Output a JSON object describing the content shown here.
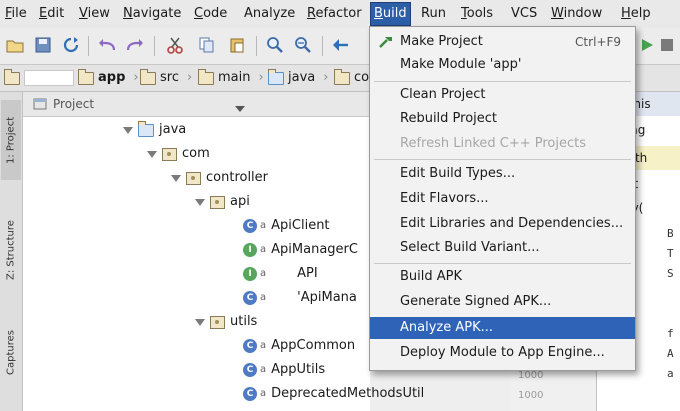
{
  "menubar": {
    "items": [
      {
        "label": "File",
        "mnemonic": "F",
        "rest": "ile"
      },
      {
        "label": "Edit",
        "mnemonic": "E",
        "rest": "dit"
      },
      {
        "label": "View",
        "mnemonic": "V",
        "rest": "iew"
      },
      {
        "label": "Navigate",
        "mnemonic": "N",
        "rest": "avigate"
      },
      {
        "label": "Code",
        "mnemonic": "C",
        "rest": "ode"
      },
      {
        "label": "Analyze",
        "mnemonic": "",
        "rest": "Analyze"
      },
      {
        "label": "Refactor",
        "mnemonic": "R",
        "rest": "efactor"
      },
      {
        "label": "Build",
        "mnemonic": "B",
        "rest": "uild"
      },
      {
        "label": "Run",
        "mnemonic": "",
        "rest": "Run"
      },
      {
        "label": "Tools",
        "mnemonic": "T",
        "rest": "ools"
      },
      {
        "label": "VCS",
        "mnemonic": "",
        "rest": "VCS"
      },
      {
        "label": "Window",
        "mnemonic": "W",
        "rest": "indow"
      },
      {
        "label": "Help",
        "mnemonic": "H",
        "rest": "elp"
      }
    ]
  },
  "breadcrumb": {
    "items": [
      "app",
      "src",
      "main",
      "java",
      "co"
    ]
  },
  "project_panel": {
    "title": "Project"
  },
  "left_strip": {
    "tabs": [
      "1: Project",
      "Z: Structure",
      "Captures"
    ]
  },
  "tree": {
    "rows": [
      {
        "label": "java",
        "kind": "folder"
      },
      {
        "label": "com",
        "kind": "package"
      },
      {
        "label": "controller",
        "kind": "package"
      },
      {
        "label": "api",
        "kind": "package"
      },
      {
        "label": "ApiClient",
        "kind": "class",
        "badge": "c"
      },
      {
        "label": "ApiManagerC",
        "kind": "interface",
        "badge": "i"
      },
      {
        "label": "API",
        "kind": "interface",
        "badge": "i"
      },
      {
        "label": "'ApiMana",
        "kind": "class",
        "badge": "c"
      },
      {
        "label": "utils",
        "kind": "package"
      },
      {
        "label": "AppCommon",
        "kind": "class",
        "badge": "c"
      },
      {
        "label": "AppUtils",
        "kind": "class",
        "badge": "c"
      },
      {
        "label": "DeprecatedMethodsUtil",
        "kind": "class",
        "badge": "c"
      }
    ]
  },
  "editor": {
    "tabs": [
      "eptionis",
      "rmFrag",
      "ed with",
      "strat",
      "sibilty("
    ],
    "code_chars": [
      "B",
      "T",
      "S",
      "f",
      "A",
      "a"
    ],
    "line_numbers": [
      "1000",
      "1000"
    ]
  },
  "build_menu": {
    "items": [
      {
        "label": "Make Project",
        "shortcut": "Ctrl+F9",
        "state": "normal"
      },
      {
        "label": "Make Module 'app'",
        "shortcut": "",
        "state": "normal"
      },
      {
        "label": "Clean Project",
        "shortcut": "",
        "state": "normal"
      },
      {
        "label": "Rebuild Project",
        "shortcut": "",
        "state": "normal"
      },
      {
        "label": "Refresh Linked C++ Projects",
        "shortcut": "",
        "state": "disabled"
      },
      {
        "label": "Edit Build Types...",
        "shortcut": "",
        "state": "normal"
      },
      {
        "label": "Edit Flavors...",
        "shortcut": "",
        "state": "normal"
      },
      {
        "label": "Edit Libraries and Dependencies...",
        "shortcut": "",
        "state": "normal"
      },
      {
        "label": "Select Build Variant...",
        "shortcut": "",
        "state": "normal"
      },
      {
        "label": "Build APK",
        "shortcut": "",
        "state": "normal"
      },
      {
        "label": "Generate Signed APK...",
        "shortcut": "",
        "state": "normal"
      },
      {
        "label": "Analyze APK...",
        "shortcut": "",
        "state": "highlighted"
      },
      {
        "label": "Deploy Module to App Engine...",
        "shortcut": "",
        "state": "normal"
      }
    ]
  },
  "colors": {
    "highlight": "#2e63b8",
    "menu_bg": "#f2f2f2",
    "class_badge": "#4f7ac4",
    "interface_badge": "#58a55c"
  }
}
